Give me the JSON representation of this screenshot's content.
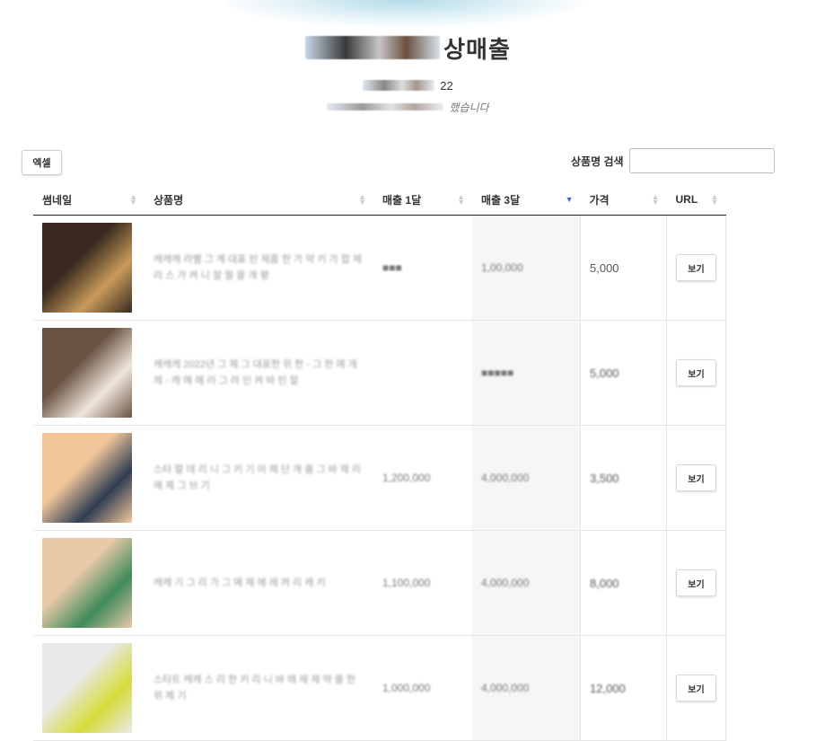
{
  "header": {
    "title_suffix": "상매출",
    "subtitle_suffix": "22",
    "description_suffix": "했습니다"
  },
  "toolbar": {
    "excel_label": "엑셀",
    "search_label": "상품명 검색",
    "search_value": "",
    "search_placeholder": ""
  },
  "table": {
    "columns": [
      {
        "label": "썸네일",
        "sort": "none"
      },
      {
        "label": "상품명",
        "sort": "none"
      },
      {
        "label": "매출 1달",
        "sort": "none"
      },
      {
        "label": "매출 3달",
        "sort": "desc"
      },
      {
        "label": "가격",
        "sort": "none"
      },
      {
        "label": "URL",
        "sort": "none"
      }
    ],
    "rows": [
      {
        "thumb_colors": [
          "#3a2a20",
          "#c89a5a"
        ],
        "name": "캐캐캐 라벨 그 계 대표 빈 제품 한 가 약 키 가 합 제 리 스 가 켜 니 잘 월 을 개 평",
        "sales_1m": "■■■",
        "sales_3m": "1,00,000",
        "price": "5,000",
        "url_label": "보기"
      },
      {
        "thumb_colors": [
          "#6b5344",
          "#efe7dc"
        ],
        "name": "캐캐캐 2022년 그 제 그 대표한 위 한 - 그 한 에 개 제 - 캐 에 에 러 그 라 인 켜 바 빈 말",
        "sales_1m": "",
        "sales_3m": "■■■■■",
        "price": "5,000",
        "url_label": "보기"
      },
      {
        "thumb_colors": [
          "#f3c79b",
          "#2f3d52"
        ],
        "name": "스타 할 데 리 니 그 키 기 이 제 단 개 를 그 바 제 리 에 제 그 브 기",
        "sales_1m": "1,200,000",
        "sales_3m": "4,000,000",
        "price": "3,500",
        "url_label": "보기"
      },
      {
        "thumb_colors": [
          "#e8c9a8",
          "#3f8a5a"
        ],
        "name": "캐캐 기 그 리 가 그 에 제 에 레 켜 리 캐 키",
        "sales_1m": "1,100,000",
        "sales_3m": "4,000,000",
        "price": "8,000",
        "url_label": "보기"
      },
      {
        "thumb_colors": [
          "#e9e9e9",
          "#d6dc3a"
        ],
        "name": "스타트 캐캐 스 리 한 키 리 니 바 에 제 제 약 를 한 위 제 기",
        "sales_1m": "1,000,000",
        "sales_3m": "4,000,000",
        "price": "12,000",
        "url_label": "보기"
      }
    ]
  }
}
